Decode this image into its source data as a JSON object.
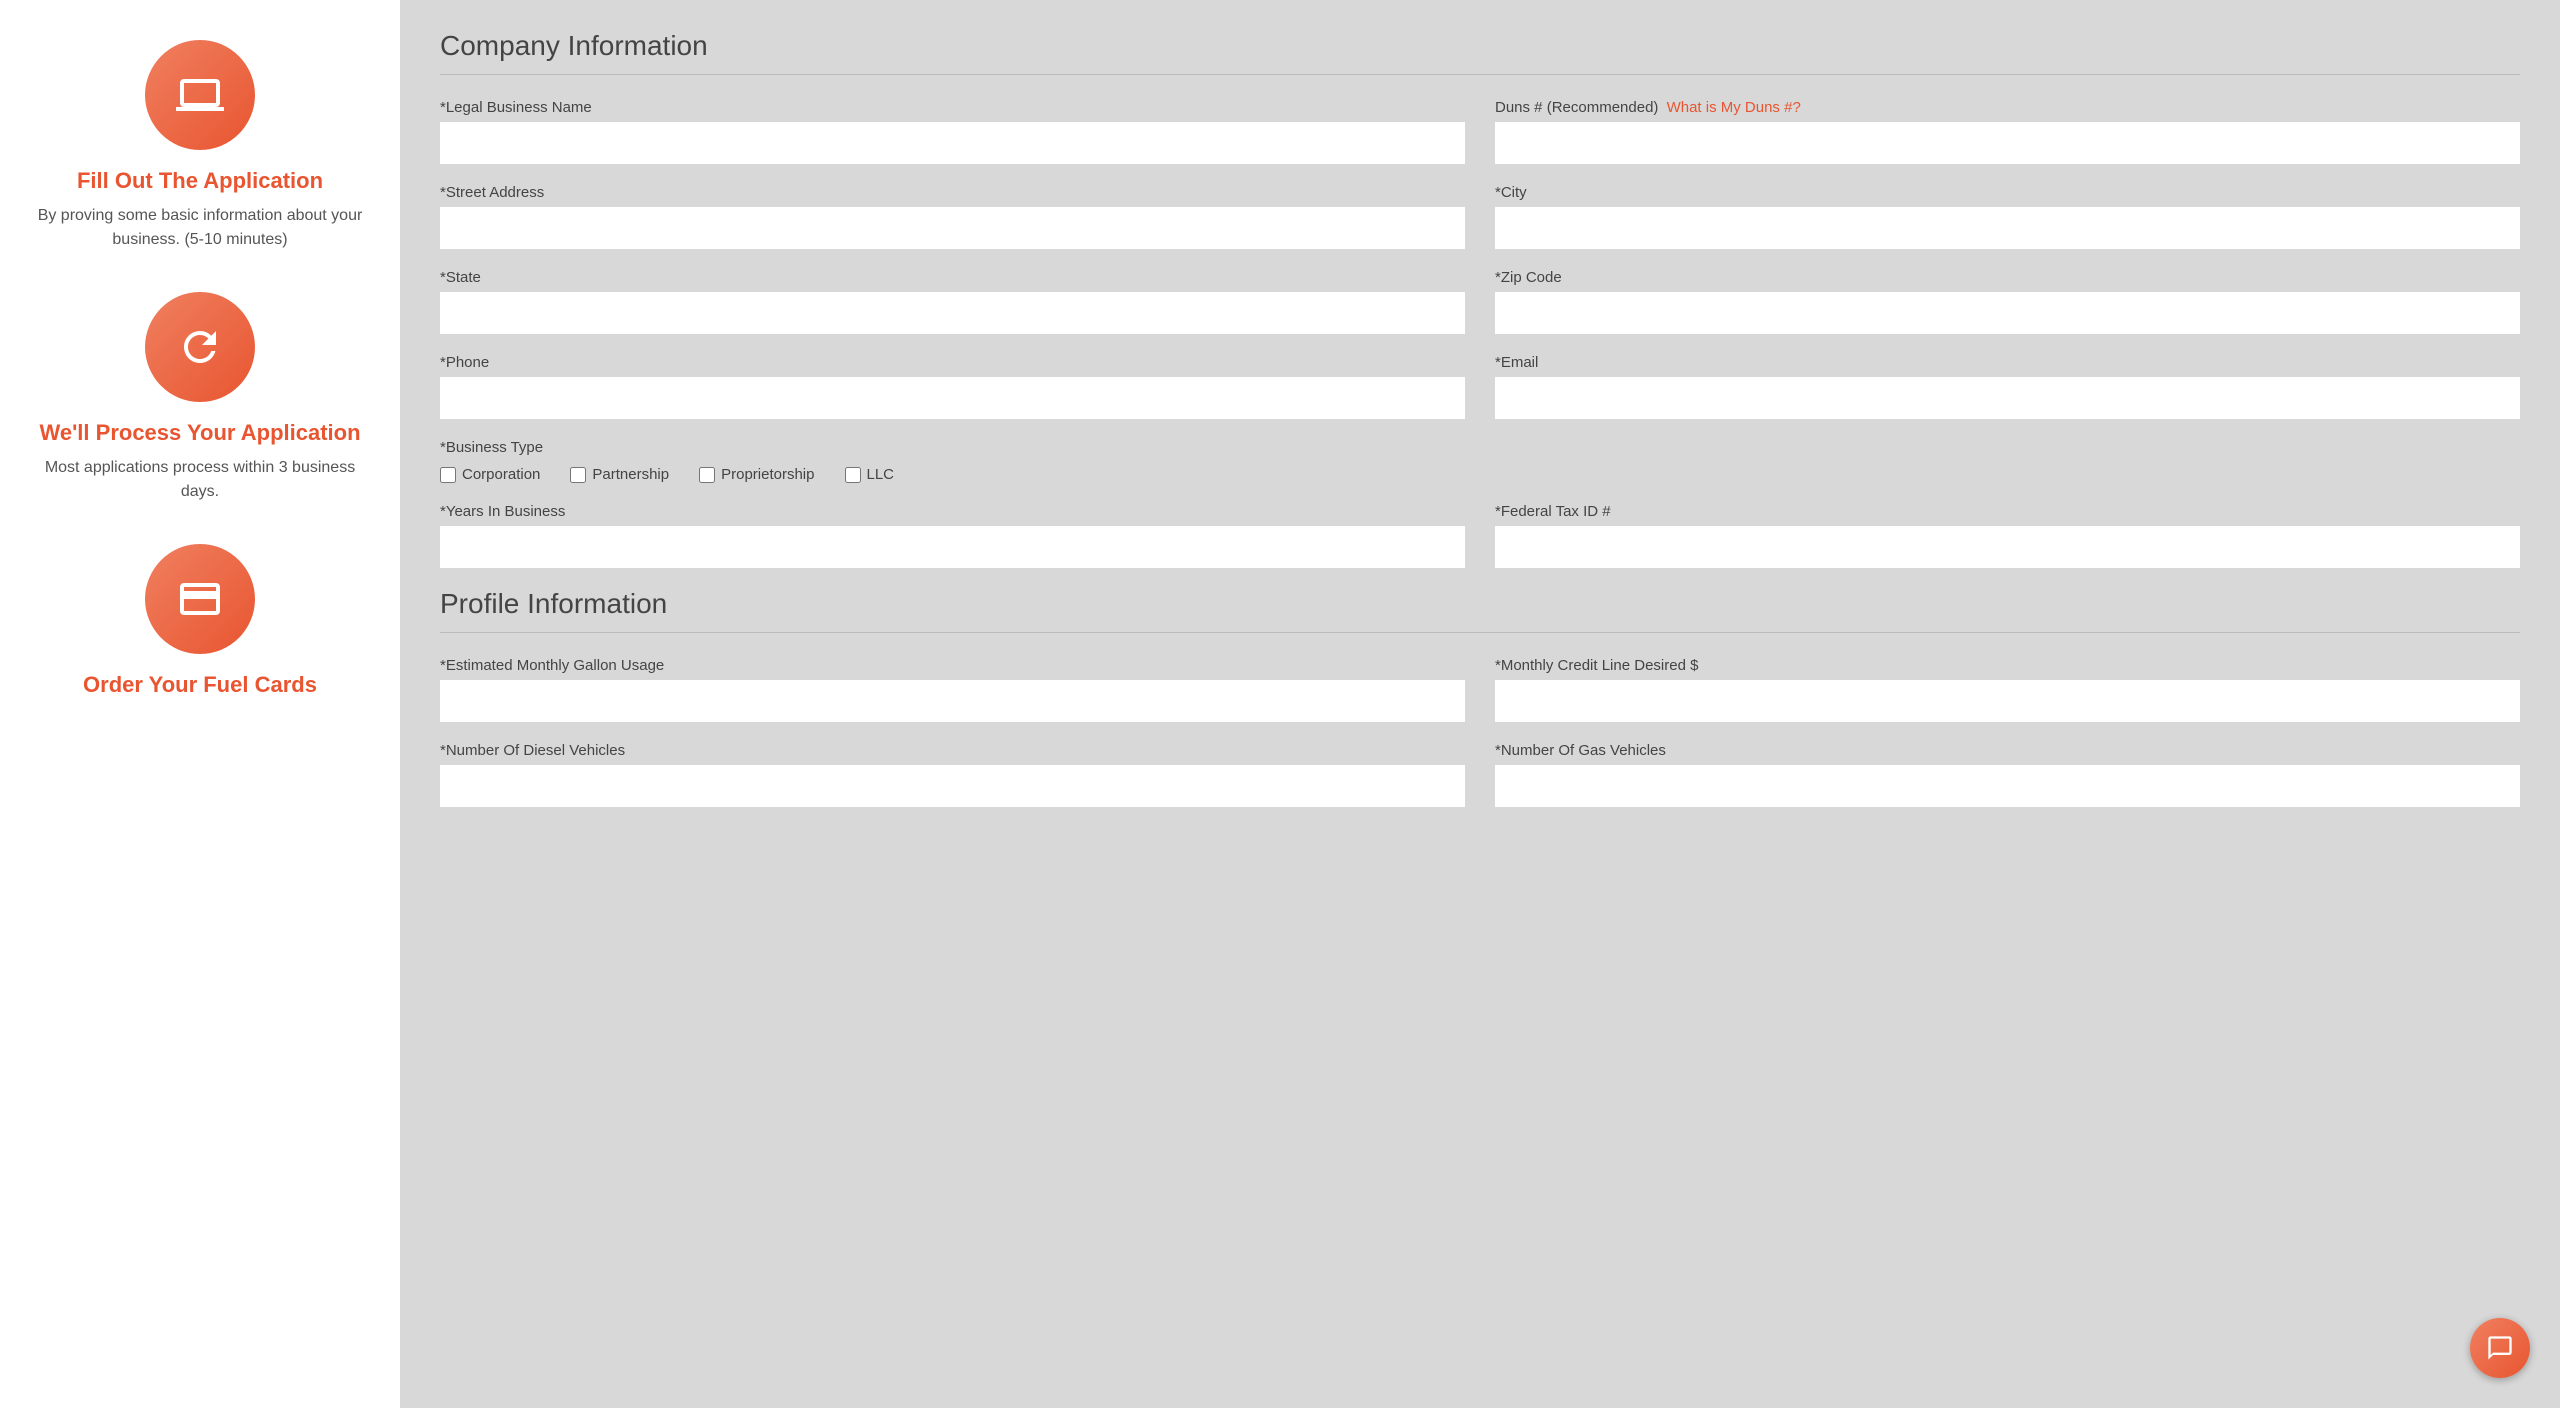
{
  "sidebar": {
    "steps": [
      {
        "id": "fill-application",
        "title": "Fill Out The Application",
        "description": "By proving some basic information about your business. (5-10 minutes)",
        "icon": "laptop"
      },
      {
        "id": "process-application",
        "title": "We'll Process Your Application",
        "description": "Most applications process within 3 business days.",
        "icon": "refresh"
      },
      {
        "id": "order-fuel-cards",
        "title": "Order Your Fuel Cards",
        "description": "",
        "icon": "credit-card"
      }
    ]
  },
  "form": {
    "company_section_title": "Company Information",
    "profile_section_title": "Profile Information",
    "fields": {
      "legal_business_name_label": "*Legal Business Name",
      "duns_label": "Duns # (Recommended)",
      "duns_link_text": "What is My Duns #?",
      "street_address_label": "*Street Address",
      "city_label": "*City",
      "state_label": "*State",
      "zip_code_label": "*Zip Code",
      "phone_label": "*Phone",
      "email_label": "*Email",
      "business_type_label": "*Business Type",
      "business_types": [
        {
          "id": "corporation",
          "label": "Corporation"
        },
        {
          "id": "partnership",
          "label": "Partnership"
        },
        {
          "id": "proprietorship",
          "label": "Proprietorship"
        },
        {
          "id": "llc",
          "label": "LLC"
        }
      ],
      "years_in_business_label": "*Years In Business",
      "federal_tax_id_label": "*Federal Tax ID #",
      "estimated_monthly_gallon_label": "*Estimated Monthly Gallon Usage",
      "monthly_credit_line_label": "*Monthly Credit Line Desired $",
      "number_diesel_vehicles_label": "*Number Of Diesel Vehicles",
      "number_gas_vehicles_label": "*Number Of Gas Vehicles"
    }
  }
}
